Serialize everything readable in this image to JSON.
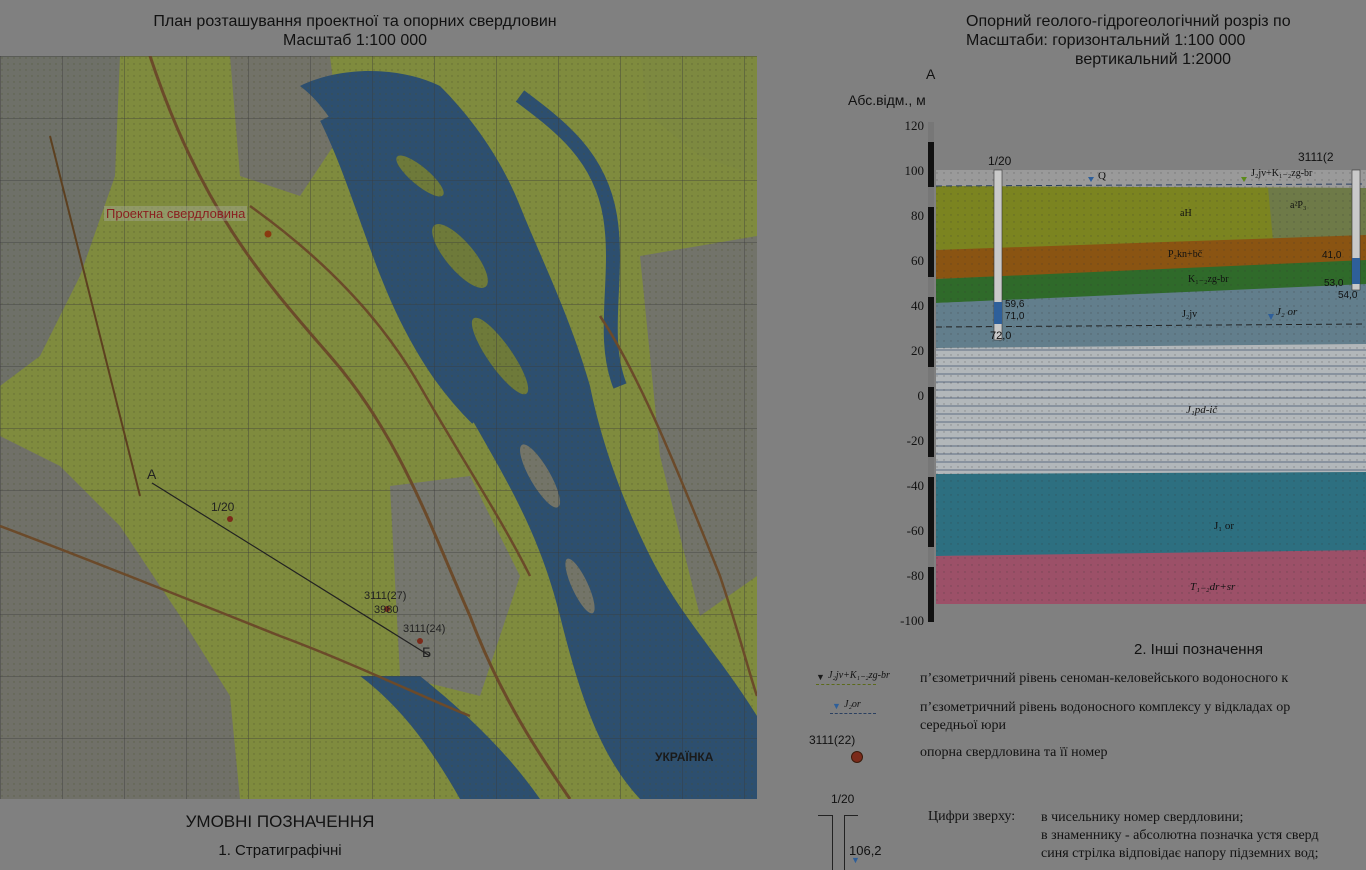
{
  "plan": {
    "title_line1": "План розташування проектної та опорних свердловин",
    "title_line2": "Масштаб 1:100 000",
    "label_project_well": "Проектна свердловина",
    "label_a": "А",
    "label_b": "Б",
    "label_well_1_20": "1/20",
    "label_well_3111_27": "3111(27)",
    "label_well_3980": "3980",
    "label_well_3111_24": "3111(24)",
    "place_ukrainka": "УКРАЇНКА"
  },
  "legend": {
    "title": "УМОВНІ ПОЗНАЧЕННЯ",
    "strat_title": "1. Стратиграфічні",
    "other_title": "2. Інші позначення",
    "item1_symbol": "J₂jv+K₁₋₂zg-br",
    "item1_text": "п’єзометричний рівень сеноман-келовейського водоносного к",
    "item2_symbol": "J₂or",
    "item2_text_line1": "п’єзометричний рівень водоносного комплексу у відкладах ор",
    "item2_text_line2": "середньої юри",
    "item3_symbol": "3111(22)",
    "item3_text": "опорна свердловина та її номер",
    "item4_symbol": "1/20",
    "item4_value": "106,2",
    "item4_caption": "Цифри зверху:",
    "item4_line1": "в чисельнику номер свердловини;",
    "item4_line2": "в знаменнику - абсолютна позначка устя сверд",
    "item4_line3": "синя стрілка відповідає напору підземних вод;"
  },
  "section": {
    "title_line1": "Опорний геолого-гідрогеологічний розріз по",
    "title_line2": "Масштаби: горизонтальний 1:100 000",
    "title_line3": "вертикальний    1:2000",
    "label_a": "А",
    "axis_label": "Абс.відм., м",
    "y_ticks": [
      "120",
      "100",
      "80",
      "60",
      "40",
      "20",
      "0",
      "-20",
      "-40",
      "-60",
      "-80",
      "-100"
    ],
    "well_left": "1/20",
    "well_right": "3111(2",
    "layer_q": "Q",
    "layer_j2jv_top": "J₂jv+K₁₋₂zg-br",
    "layer_ah": "aH",
    "layer_a2p": "a²P₃",
    "layer_p2kn": "P₂kn+bč",
    "layer_k1": "K₁₋₂zg-br",
    "layer_j2jv": "J₂jv",
    "layer_j2or_level": "J₂ or",
    "layer_j1pd": "J₁pd-ič",
    "layer_j1or": "J₁ or",
    "layer_t": "T₁₋₂dr+sr",
    "left_well_v1": "59,6",
    "left_well_v2": "71,0",
    "left_well_v3": "72,0",
    "right_well_v1": "41,0",
    "right_well_v2": "53,0",
    "right_well_v3": "54,0"
  },
  "colors": {
    "map_green": "#7f8b3e",
    "map_water": "#2d4f6f",
    "layer_yellow": "#7b8420",
    "layer_orange": "#8a5412",
    "layer_green": "#2f6a2a",
    "layer_lightblue": "#627e8c",
    "layer_stripes": "#b2b7ba",
    "layer_teal": "#2d6f80",
    "layer_pink": "#9c5068"
  }
}
